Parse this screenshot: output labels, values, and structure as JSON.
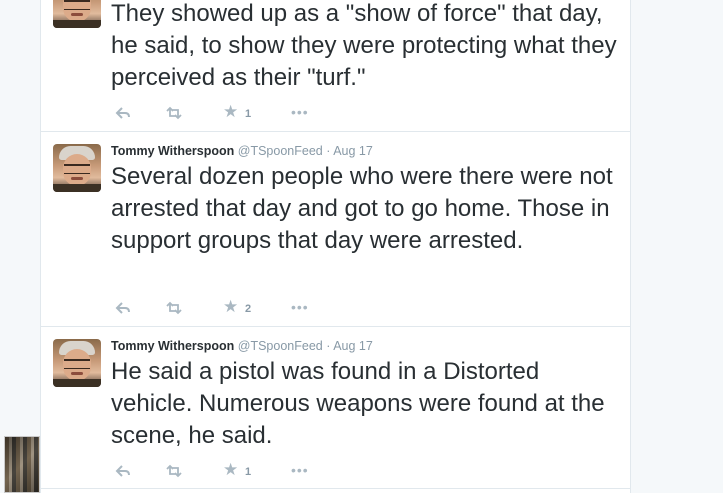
{
  "tweets": [
    {
      "text": "They showed up as a \"show of force\" that day, he said, to show they were protecting what they perceived as their \"turf.\"",
      "favorites": "1"
    },
    {
      "name": "Tommy Witherspoon",
      "handle": "@TSpoonFeed",
      "separator": "·",
      "time": "Aug 17",
      "text": "Several dozen people who were there were not arrested that day and got to go home. Those in support groups that day were arrested.",
      "favorites": "2"
    },
    {
      "name": "Tommy Witherspoon",
      "handle": "@TSpoonFeed",
      "separator": "·",
      "time": "Aug 17",
      "text": "He said a pistol was found in a Distorted vehicle. Numerous weapons were found at the scene, he said.",
      "favorites": "1"
    }
  ],
  "icons": {
    "reply": "reply-icon",
    "retweet": "retweet-icon",
    "favorite": "star-icon",
    "more": "more-icon",
    "star_glyph": "★",
    "more_glyph": "•••"
  },
  "colors": {
    "text": "#292f33",
    "secondary": "#8899a6",
    "action_icons": "#aab8c2",
    "divider": "#e1e8ed"
  }
}
